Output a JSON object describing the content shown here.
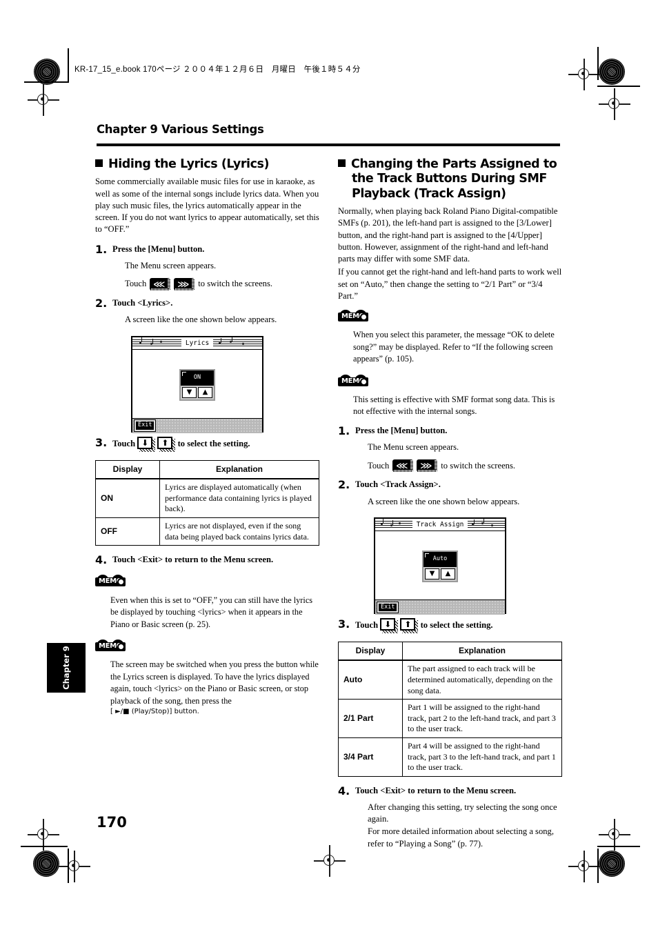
{
  "print_slug": "KR-17_15_e.book  170ページ  ２００４年１２月６日　月曜日　午後１時５４分",
  "chapter_header": "Chapter 9 Various Settings",
  "page_number": "170",
  "side_tab": "Chapter 9",
  "left_column": {
    "heading": "Hiding the Lyrics (Lyrics)",
    "intro": "Some commercially available music files for use in karaoke, as well as some of the internal songs include lyrics data. When you play such music files, the lyrics automatically appear in the screen. If you do not want lyrics to appear automatically, set this to “OFF.”",
    "steps": [
      {
        "num": "1.",
        "title": "Press the [Menu] button.",
        "sub": "The Menu screen appears.",
        "touch_prefix": "Touch",
        "touch_suffix": "to switch the screens.",
        "icons": [
          "prev-screen-icon",
          "next-screen-icon"
        ]
      },
      {
        "num": "2.",
        "title": "Touch <Lyrics>.",
        "sub": "A screen like the one shown below appears."
      },
      {
        "num": "3.",
        "title_prefix": "Touch",
        "title_suffix": "to select the setting.",
        "icons": [
          "down-arrow-icon",
          "up-arrow-icon"
        ]
      },
      {
        "num": "4.",
        "title": "Touch <Exit> to return to the Menu screen."
      }
    ],
    "lcd": {
      "title": "Lyrics",
      "value": "ON",
      "down_arrow": "▼",
      "up_arrow": "▲",
      "exit_label": "Exit"
    },
    "table": {
      "headers": [
        "Display",
        "Explanation"
      ],
      "rows": [
        [
          "ON",
          "Lyrics are displayed automatically (when performance data containing lyrics is played back)."
        ],
        [
          "OFF",
          "Lyrics are not displayed, even if the song data being played back contains lyrics data."
        ]
      ]
    },
    "memos": [
      {
        "badge": "MEMO",
        "text": "Even when this is set to “OFF,” you can still have the lyrics be displayed by touching <lyrics> when it appears in the Piano or Basic screen (p. 25)."
      },
      {
        "badge": "MEMO",
        "text_parts": {
          "before": "The screen may be switched when you press the button while the Lyrics screen is displayed. To have the lyrics displayed again, touch <lyrics> on the Piano or Basic screen, or stop playback of the song, then press the",
          "button": "[ ►/■  (Play/Stop)] button."
        }
      }
    ]
  },
  "right_column": {
    "heading": "Changing the Parts Assigned to the Track Buttons During SMF Playback (Track Assign)",
    "intro_p1": "Normally, when playing back Roland Piano Digital-compatible SMFs (p. 201), the left-hand part is assigned to the [3/Lower] button, and the right-hand part is assigned to the [4/Upper] button. However, assignment of the right-hand and left-hand parts may differ with some SMF data.",
    "intro_p2": "If you cannot get the right-hand and left-hand parts to work well set on “Auto,” then change the setting to “2/1 Part” or “3/4 Part.”",
    "memos": [
      {
        "badge": "MEMO",
        "text": "When you select this parameter, the message “OK to delete song?” may be displayed. Refer to “If the following screen appears” (p. 105)."
      },
      {
        "badge": "MEMO",
        "text": "This setting is effective with SMF format song data. This is not effective with the internal songs."
      }
    ],
    "steps": [
      {
        "num": "1.",
        "title": "Press the [Menu] button.",
        "sub": "The Menu screen appears.",
        "touch_prefix": "Touch",
        "touch_suffix": "to switch the screens.",
        "icons": [
          "prev-screen-icon",
          "next-screen-icon"
        ]
      },
      {
        "num": "2.",
        "title": "Touch <Track Assign>.",
        "sub": "A screen like the one shown below appears."
      },
      {
        "num": "3.",
        "title_prefix": "Touch",
        "title_suffix": "to select the setting.",
        "icons": [
          "down-arrow-icon",
          "up-arrow-icon"
        ]
      },
      {
        "num": "4.",
        "title": "Touch <Exit> to return to the Menu screen.",
        "sub1": "After changing this setting, try selecting the song once again.",
        "sub2": "For more detailed information about selecting a song, refer to “Playing a Song” (p. 77)."
      }
    ],
    "lcd": {
      "title": "Track Assign",
      "value": "Auto",
      "down_arrow": "▼",
      "up_arrow": "▲",
      "exit_label": "Exit"
    },
    "table": {
      "headers": [
        "Display",
        "Explanation"
      ],
      "rows": [
        [
          "Auto",
          "The part assigned to each track will be determined automatically, depending on the song data."
        ],
        [
          "2/1 Part",
          "Part 1 will be assigned to the right-hand track, part 2 to the left-hand track, and part 3 to the user track."
        ],
        [
          "3/4 Part",
          "Part 4 will be assigned to the right-hand track, part 3 to the left-hand track, and part 1 to the user track."
        ]
      ]
    }
  },
  "icon_glyphs": {
    "prev": "⋘",
    "next": "⋙",
    "down": "⬇",
    "up": "⬆"
  }
}
